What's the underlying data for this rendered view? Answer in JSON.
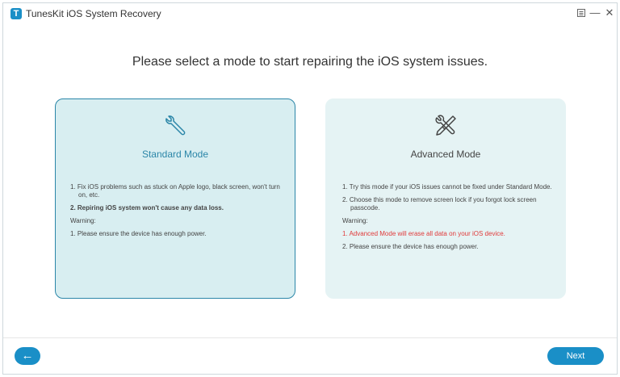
{
  "window": {
    "title": "TunesKit iOS System Recovery",
    "logo_letter": "T",
    "menu_icon": "menu-icon",
    "minimize_glyph": "—",
    "close_glyph": "✕"
  },
  "headline": "Please select a mode to start repairing the iOS system issues.",
  "standard": {
    "title": "Standard Mode",
    "icon": "wrench-icon",
    "line1": "1. Fix iOS problems such as stuck on Apple logo, black screen, won't turn on, etc.",
    "line2": "2. Repiring iOS system won't cause any data loss.",
    "warning_label": "Warning:",
    "warning1": "1. Please ensure the device has enough power."
  },
  "advanced": {
    "title": "Advanced Mode",
    "icon": "tools-icon",
    "line1": "1. Try this mode if your iOS issues cannot be fixed under Standard Mode.",
    "line2": "2. Choose this mode to remove screen lock if you forgot lock screen passcode.",
    "warning_label": "Warning:",
    "warning1": "1. Advanced Mode will erase all data on your iOS device.",
    "warning2": "2. Please ensure the device has enough power."
  },
  "footer": {
    "back_glyph": "←",
    "next_label": "Next"
  },
  "colors": {
    "accent": "#1a8fc7",
    "selected_border": "#2b86a8",
    "warning_red": "#e03a3a"
  }
}
